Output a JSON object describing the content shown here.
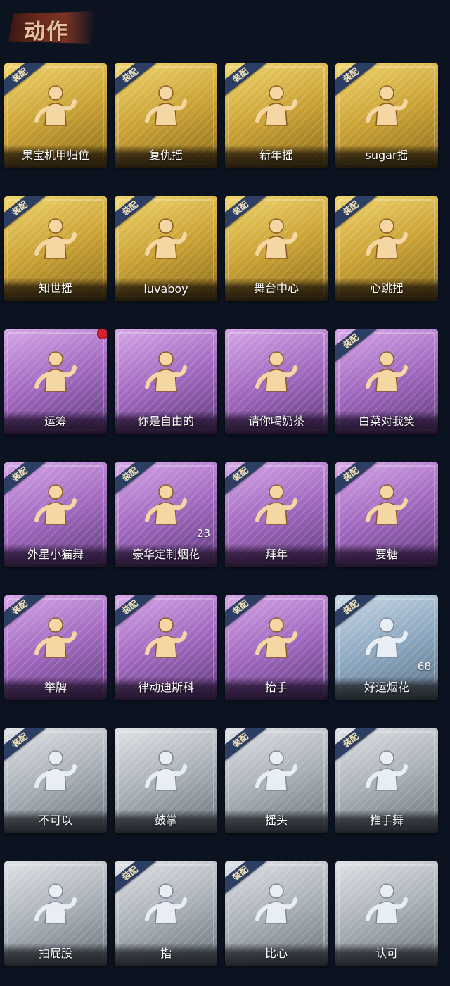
{
  "header": {
    "title": "动作"
  },
  "equipped_label": "装配",
  "colors": {
    "background": "#0c1320",
    "gold": "#caa234",
    "purple": "#a168bf",
    "blue": "#8ca7c0",
    "gray": "#a9afb7",
    "badge": "#2c3e63",
    "notification": "#d2222e"
  },
  "cards": [
    {
      "label": "果宝机甲归位",
      "rarity": "gold",
      "equipped": true,
      "icon": "dance-pose-icon"
    },
    {
      "label": "复仇摇",
      "rarity": "gold",
      "equipped": true,
      "icon": "point-up-dance-icon"
    },
    {
      "label": "新年摇",
      "rarity": "gold",
      "equipped": true,
      "icon": "clap-dance-icon"
    },
    {
      "label": "sugar摇",
      "rarity": "gold",
      "equipped": true,
      "icon": "sway-dance-icon"
    },
    {
      "label": "知世摇",
      "rarity": "gold",
      "equipped": true,
      "icon": "music-dance-icon"
    },
    {
      "label": "luvaboy",
      "rarity": "gold",
      "equipped": true,
      "icon": "cross-arm-dance-icon"
    },
    {
      "label": "舞台中心",
      "rarity": "gold",
      "equipped": true,
      "icon": "stage-pose-icon"
    },
    {
      "label": "心跳摇",
      "rarity": "gold",
      "equipped": true,
      "icon": "heartbeat-dance-icon"
    },
    {
      "label": "运筹",
      "rarity": "purple",
      "equipped": false,
      "icon": "strategist-fan-icon",
      "notification": true
    },
    {
      "label": "你是自由的",
      "rarity": "purple",
      "equipped": false,
      "icon": "free-puppet-icon"
    },
    {
      "label": "请你喝奶茶",
      "rarity": "purple",
      "equipped": false,
      "icon": "milk-tea-sign-icon"
    },
    {
      "label": "白菜对我笑",
      "rarity": "purple",
      "equipped": true,
      "icon": "cabbage-smile-icon"
    },
    {
      "label": "外星小猫舞",
      "rarity": "purple",
      "equipped": true,
      "icon": "alien-cat-dance-icon"
    },
    {
      "label": "豪华定制烟花",
      "rarity": "purple",
      "equipped": true,
      "icon": "fireworks-icon",
      "count": "23"
    },
    {
      "label": "拜年",
      "rarity": "purple",
      "equipped": true,
      "icon": "bow-greeting-icon"
    },
    {
      "label": "要糖",
      "rarity": "purple",
      "equipped": true,
      "icon": "ask-candy-icon"
    },
    {
      "label": "举牌",
      "rarity": "purple",
      "equipped": true,
      "icon": "hold-sign-icon"
    },
    {
      "label": "律动迪斯科",
      "rarity": "purple",
      "equipped": true,
      "icon": "disco-icon"
    },
    {
      "label": "抬手",
      "rarity": "purple",
      "equipped": true,
      "icon": "raise-hand-icon"
    },
    {
      "label": "好运烟花",
      "rarity": "blue",
      "equipped": true,
      "icon": "lucky-firework-icon",
      "count": "68"
    },
    {
      "label": "不可以",
      "rarity": "gray",
      "equipped": true,
      "icon": "wag-finger-icon"
    },
    {
      "label": "鼓掌",
      "rarity": "gray",
      "equipped": false,
      "icon": "applause-icon"
    },
    {
      "label": "摇头",
      "rarity": "gray",
      "equipped": true,
      "icon": "shake-head-icon"
    },
    {
      "label": "推手舞",
      "rarity": "gray",
      "equipped": true,
      "icon": "push-hand-dance-icon"
    },
    {
      "label": "拍屁股",
      "rarity": "gray",
      "equipped": false,
      "icon": "slap-butt-icon"
    },
    {
      "label": "指",
      "rarity": "gray",
      "equipped": true,
      "icon": "point-icon"
    },
    {
      "label": "比心",
      "rarity": "gray",
      "equipped": true,
      "icon": "finger-heart-icon"
    },
    {
      "label": "认可",
      "rarity": "gray",
      "equipped": false,
      "icon": "thumbs-up-icon"
    }
  ]
}
